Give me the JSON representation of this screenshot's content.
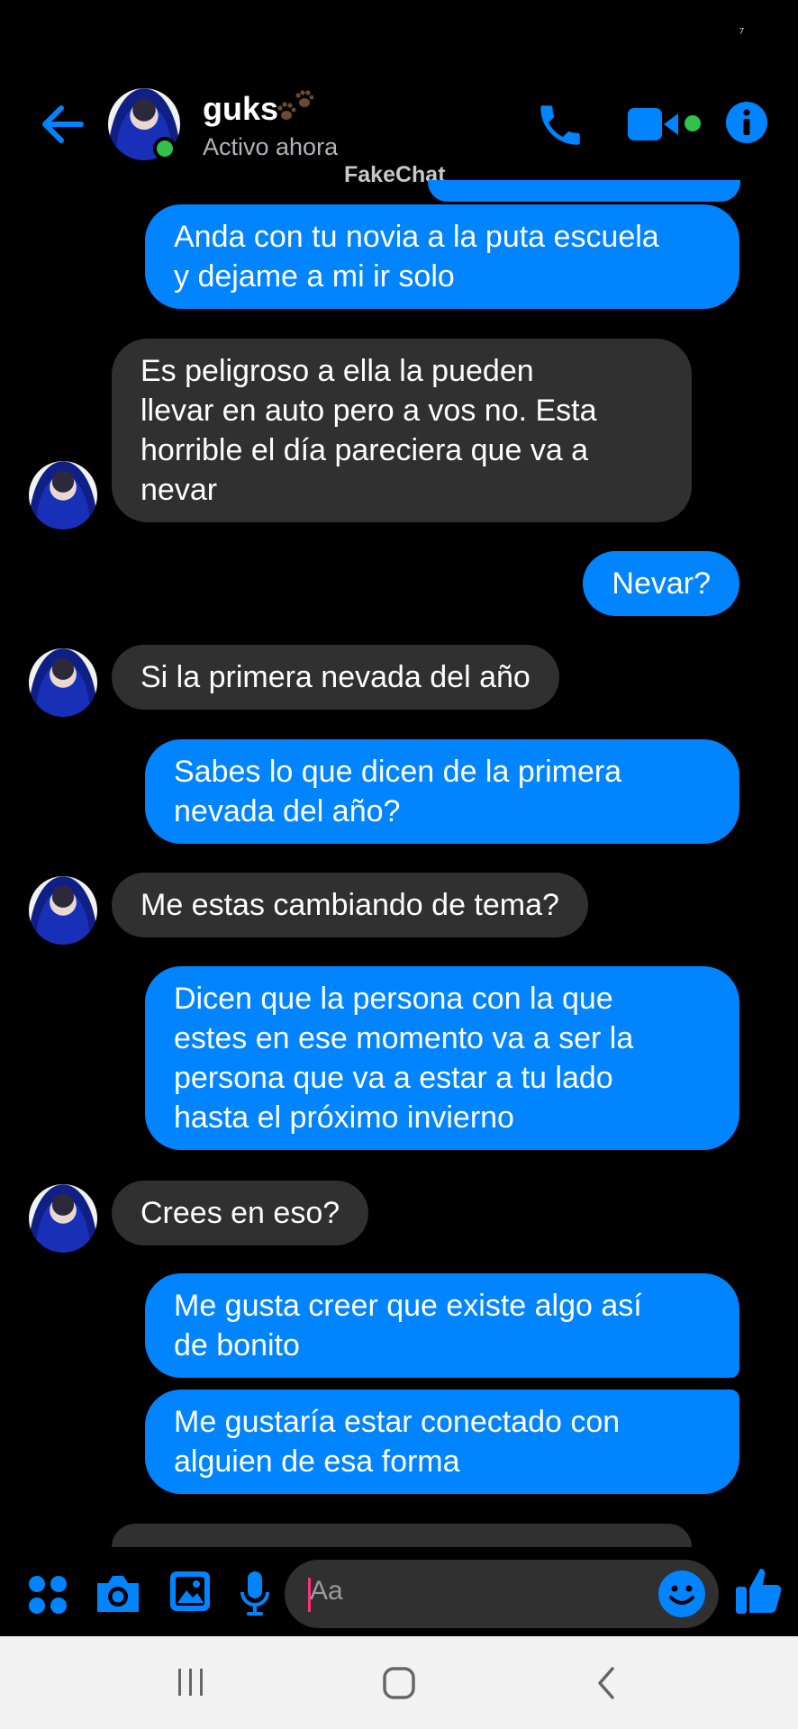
{
  "status_bar": {
    "glyph": "⁷"
  },
  "header": {
    "contact_name": "guks",
    "contact_status": "Activo ahora",
    "watermark": "FakeChat",
    "accent_color": "#0084ff",
    "online_color": "#31c24d",
    "icons": [
      "back-arrow-icon",
      "phone-icon",
      "video-camera-icon",
      "info-icon"
    ]
  },
  "messages": [
    {
      "from": "me",
      "lines": [
        "Anda con tu novia a la puta escuela",
        "y dejame a mi ir solo"
      ]
    },
    {
      "from": "them",
      "lines": [
        "Es peligroso a ella la pueden",
        "llevar en auto pero a vos no. Esta",
        "horrible el día pareciera que va a",
        "nevar"
      ]
    },
    {
      "from": "me",
      "lines": [
        "Nevar?"
      ]
    },
    {
      "from": "them",
      "lines": [
        "Si la primera nevada del año"
      ]
    },
    {
      "from": "me",
      "lines": [
        "Sabes lo que dicen de la primera",
        "nevada del año?"
      ]
    },
    {
      "from": "them",
      "lines": [
        "Me estas cambiando de tema?"
      ]
    },
    {
      "from": "me",
      "lines": [
        "Dicen que la persona con la que",
        "estes en ese momento va a ser la",
        "persona que va a estar a tu lado",
        "hasta el próximo invierno"
      ]
    },
    {
      "from": "them",
      "lines": [
        "Crees en eso?"
      ]
    },
    {
      "from": "me",
      "lines": [
        "Me gusta creer que existe algo así",
        "de bonito"
      ]
    },
    {
      "from": "me",
      "lines": [
        "Me gustaría estar conectado con",
        "alguien de esa forma"
      ]
    }
  ],
  "composer": {
    "placeholder": "Aa",
    "icons": [
      "apps-icon",
      "camera-icon",
      "gallery-icon",
      "microphone-icon",
      "emoji-icon",
      "thumbs-up-icon"
    ]
  },
  "system_nav": {
    "icons": [
      "recent-apps-icon",
      "home-icon",
      "back-icon"
    ]
  }
}
